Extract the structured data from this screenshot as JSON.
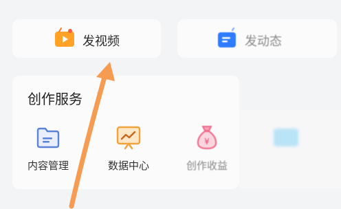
{
  "top_actions": {
    "video_label": "发视频",
    "post_label": "发动态"
  },
  "services": {
    "title": "创作服务",
    "items": [
      {
        "label": "内容管理",
        "icon": "folder-icon"
      },
      {
        "label": "数据中心",
        "icon": "chart-board-icon"
      },
      {
        "label": "创作收益",
        "icon": "money-bag-icon"
      },
      {
        "label": "",
        "icon": "more-service-icon"
      }
    ]
  },
  "colors": {
    "video_orange": "#ff9a1f",
    "post_blue": "#2f7bff",
    "folder_blue": "#5a82d6",
    "chart_orange": "#f2a23b",
    "bag_pink": "#f06b8a",
    "arrow_orange": "#f59b52"
  }
}
